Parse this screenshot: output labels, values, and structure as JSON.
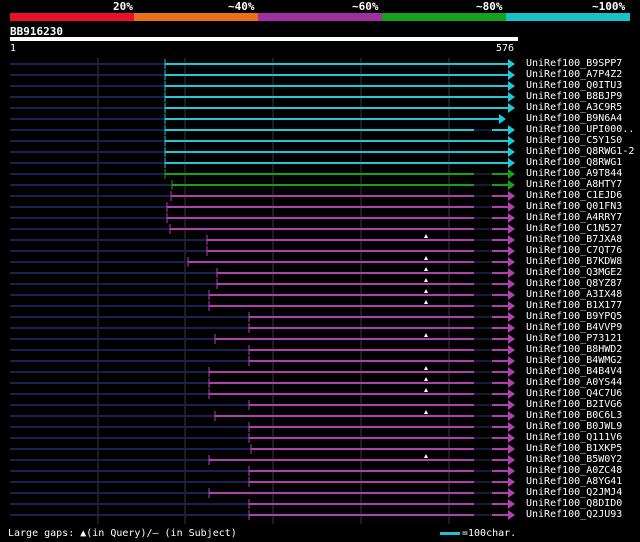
{
  "legend": {
    "colors": [
      "#e8102a",
      "#e8701a",
      "#a030a0",
      "#18a018",
      "#18c0c8"
    ],
    "labels": [
      "20%",
      "~40%",
      "~60%",
      "~80%",
      "~100%"
    ]
  },
  "query": {
    "id": "BB916230",
    "start_label": "1",
    "end_label": "576"
  },
  "hits": [
    {
      "name": "UniRef100_B9SPP7",
      "color": "cyan",
      "start": 165,
      "gaps": []
    },
    {
      "name": "UniRef100_A7P4Z2",
      "color": "cyan",
      "start": 165,
      "gaps": []
    },
    {
      "name": "UniRef100_Q0ITU3",
      "color": "cyan",
      "start": 165,
      "gaps": []
    },
    {
      "name": "UniRef100_B8BJP9",
      "color": "cyan",
      "start": 165,
      "gaps": []
    },
    {
      "name": "UniRef100_A3C9R5",
      "color": "cyan",
      "start": 165,
      "gaps": []
    },
    {
      "name": "UniRef100_B9N6A4",
      "color": "cyan",
      "start": 165,
      "gaps": [],
      "end": 505
    },
    {
      "name": "UniRef100_UPI000..",
      "color": "cyan",
      "start": 165,
      "gaps": []
    },
    {
      "name": "UniRef100_C5Y1S0",
      "color": "cyan",
      "start": 165,
      "gaps": []
    },
    {
      "name": "UniRef100_Q8RWG1-2",
      "color": "cyan",
      "start": 165,
      "gaps": []
    },
    {
      "name": "UniRef100_Q8RWG1",
      "color": "cyan",
      "start": 165,
      "gaps": []
    },
    {
      "name": "UniRef100_A9T844",
      "color": "green",
      "start": 165,
      "gaps": []
    },
    {
      "name": "UniRef100_A8HTY7",
      "color": "green",
      "start": 172,
      "gaps": []
    },
    {
      "name": "UniRef100_C1EJD6",
      "color": "purple",
      "start": 171,
      "gaps": []
    },
    {
      "name": "UniRef100_Q01FN3",
      "color": "purple",
      "start": 167,
      "gaps": []
    },
    {
      "name": "UniRef100_A4RRY7",
      "color": "purple",
      "start": 167,
      "gaps": []
    },
    {
      "name": "UniRef100_C1N527",
      "color": "purple",
      "start": 170,
      "gaps": []
    },
    {
      "name": "UniRef100_B7JXA8",
      "color": "purple",
      "start": 207,
      "gaps": [
        426
      ]
    },
    {
      "name": "UniRef100_C7QT76",
      "color": "purple",
      "start": 207,
      "gaps": []
    },
    {
      "name": "UniRef100_B7KDW8",
      "color": "purple",
      "start": 188,
      "gaps": [
        426
      ]
    },
    {
      "name": "UniRef100_Q3MGE2",
      "color": "purple",
      "start": 217,
      "gaps": [
        426
      ]
    },
    {
      "name": "UniRef100_Q8YZ87",
      "color": "purple",
      "start": 217,
      "gaps": [
        426
      ]
    },
    {
      "name": "UniRef100_A3IX48",
      "color": "purple",
      "start": 209,
      "gaps": [
        426
      ]
    },
    {
      "name": "UniRef100_B1X177",
      "color": "purple",
      "start": 209,
      "gaps": [
        426
      ]
    },
    {
      "name": "UniRef100_B9YPQ5",
      "color": "purple",
      "start": 249,
      "gaps": []
    },
    {
      "name": "UniRef100_B4VVP9",
      "color": "purple",
      "start": 249,
      "gaps": []
    },
    {
      "name": "UniRef100_P73121",
      "color": "purple",
      "start": 215,
      "gaps": [
        426
      ]
    },
    {
      "name": "UniRef100_B8HWD2",
      "color": "purple",
      "start": 249,
      "gaps": []
    },
    {
      "name": "UniRef100_B4WMG2",
      "color": "purple",
      "start": 249,
      "gaps": []
    },
    {
      "name": "UniRef100_B4B4V4",
      "color": "purple",
      "start": 209,
      "gaps": [
        426
      ]
    },
    {
      "name": "UniRef100_A0YS44",
      "color": "purple",
      "start": 209,
      "gaps": [
        426
      ]
    },
    {
      "name": "UniRef100_Q4C7U6",
      "color": "purple",
      "start": 209,
      "gaps": [
        426
      ]
    },
    {
      "name": "UniRef100_B2IVG6",
      "color": "purple",
      "start": 249,
      "gaps": []
    },
    {
      "name": "UniRef100_B0C6L3",
      "color": "purple",
      "start": 215,
      "gaps": [
        426
      ]
    },
    {
      "name": "UniRef100_B0JWL9",
      "color": "purple",
      "start": 249,
      "gaps": []
    },
    {
      "name": "UniRef100_Q111V6",
      "color": "purple",
      "start": 249,
      "gaps": []
    },
    {
      "name": "UniRef100_B1XKP5",
      "color": "purple",
      "start": 251,
      "gaps": []
    },
    {
      "name": "UniRef100_B5W0Y2",
      "color": "purple",
      "start": 209,
      "gaps": [
        426
      ]
    },
    {
      "name": "UniRef100_A0ZC48",
      "color": "purple",
      "start": 249,
      "gaps": []
    },
    {
      "name": "UniRef100_A8YG41",
      "color": "purple",
      "start": 249,
      "gaps": []
    },
    {
      "name": "UniRef100_Q2JMJ4",
      "color": "purple",
      "start": 209,
      "gaps": []
    },
    {
      "name": "UniRef100_Q8DID0",
      "color": "purple",
      "start": 249,
      "gaps": []
    },
    {
      "name": "UniRef100_Q2JU93",
      "color": "purple",
      "start": 249,
      "gaps": []
    }
  ],
  "footer": {
    "text": "Large gaps: ▲(in Query)/– (in Subject)",
    "scale": "=100char."
  }
}
